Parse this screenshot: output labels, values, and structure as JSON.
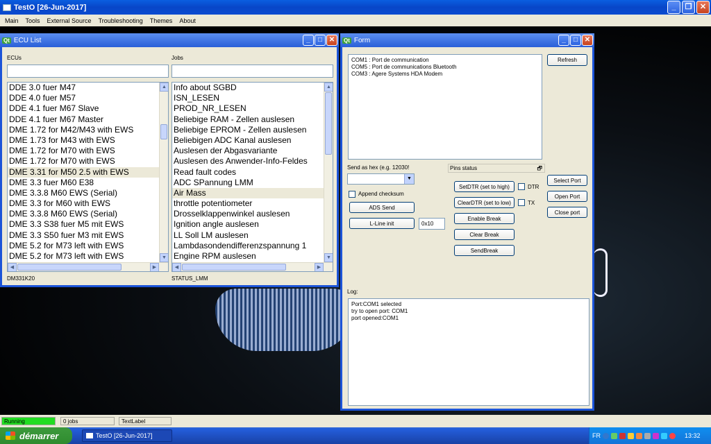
{
  "main_window": {
    "title": "TestO [26-Jun-2017]",
    "menu": [
      "Main",
      "Tools",
      "External Source",
      "Troubleshooting",
      "Themes",
      "About"
    ]
  },
  "ecu_window": {
    "title": "ECU List",
    "ecus_label": "ECUs",
    "jobs_label": "Jobs",
    "ecus_filter_value": "",
    "jobs_filter_value": "",
    "ecus": [
      "DDE 3.0 fuer M47",
      "DDE 4.0 fuer M57",
      "DDE 4.1 fuer M67 Slave",
      "DDE 4.1 fuer M67 Master",
      "DME 1.72 for M42/M43 with EWS",
      "DME 1.73 for M43 with EWS",
      "DME 1.72 for M70 with EWS",
      "DME 1.72 for M70 with EWS",
      "DME 3.31 for M50 2.5 with EWS",
      "DME 3.3 fuer M60 E38",
      "DME 3.3.8 M60 EWS (Serial)",
      "DME 3.3 for M60 with EWS",
      "DME 3.3.8 M60 EWS (Serial)",
      "DME 3.3 S38 fuer M5 mit EWS",
      "DME 3.3 S50 fuer M3 mit EWS",
      "DME 5.2 for M73 left with EWS",
      "DME 5.2 for M73 left with EWS"
    ],
    "ecus_selected_index": 8,
    "jobs": [
      "Info about SGBD",
      "ISN_LESEN",
      "PROD_NR_LESEN",
      "Beliebige RAM - Zellen auslesen",
      "Beliebige EPROM - Zellen auslesen",
      "Beliebigen ADC Kanal auslesen",
      "Auslesen der Abgasvariante",
      "Auslesen des Anwender-Info-Feldes",
      "Read fault codes",
      "ADC SPannung LMM",
      "Air Mass",
      "throttle potentiometer",
      "Drosselklappenwinkel auslesen",
      "Ignition angle auslesen",
      "LL Soll LM auslesen",
      "Lambdasondendifferenzspannung 1",
      "Engine RPM auslesen"
    ],
    "jobs_selected_index": 10,
    "ecu_status": "DM331K20",
    "job_status": "STATUS_LMM"
  },
  "form_window": {
    "title": "Form",
    "ports": [
      "COM1 : Port de communication",
      "COM5 : Port de communications Bluetooth",
      "COM3 : Agere Systems HDA Modem"
    ],
    "refresh_label": "Refresh",
    "send_hex_label": "Send as hex (e.g. 12030!",
    "pins_status_label": "Pins status",
    "append_checksum_label": "Append checksum",
    "ads_send_label": "ADS Send",
    "lline_init_label": "L-Line init",
    "lline_value": "0x10",
    "setdtr_label": "SetDTR (set to high)",
    "dtr_label": "DTR",
    "cleardtr_label": "ClearDTR (set to low)",
    "tx_label": "TX",
    "enable_break_label": "Enable Break",
    "clear_break_label": "Clear Break",
    "send_break_label": "SendBreak",
    "select_port_label": "Select Port",
    "open_port_label": "Open Port",
    "close_port_label": "Close port",
    "log_label": "Log:",
    "log_lines": [
      "Port:COM1 selected",
      "try to open port: COM1",
      "port opened:COM1"
    ]
  },
  "statusbar": {
    "running": "Running",
    "jobs": "0 jobs",
    "textlabel": "TextLabel",
    "running_color": "#22dd22"
  },
  "taskbar": {
    "start_label": "démarrer",
    "task_label": "TestO [26-Jun-2017]",
    "lang": "FR",
    "clock": "13:32"
  }
}
